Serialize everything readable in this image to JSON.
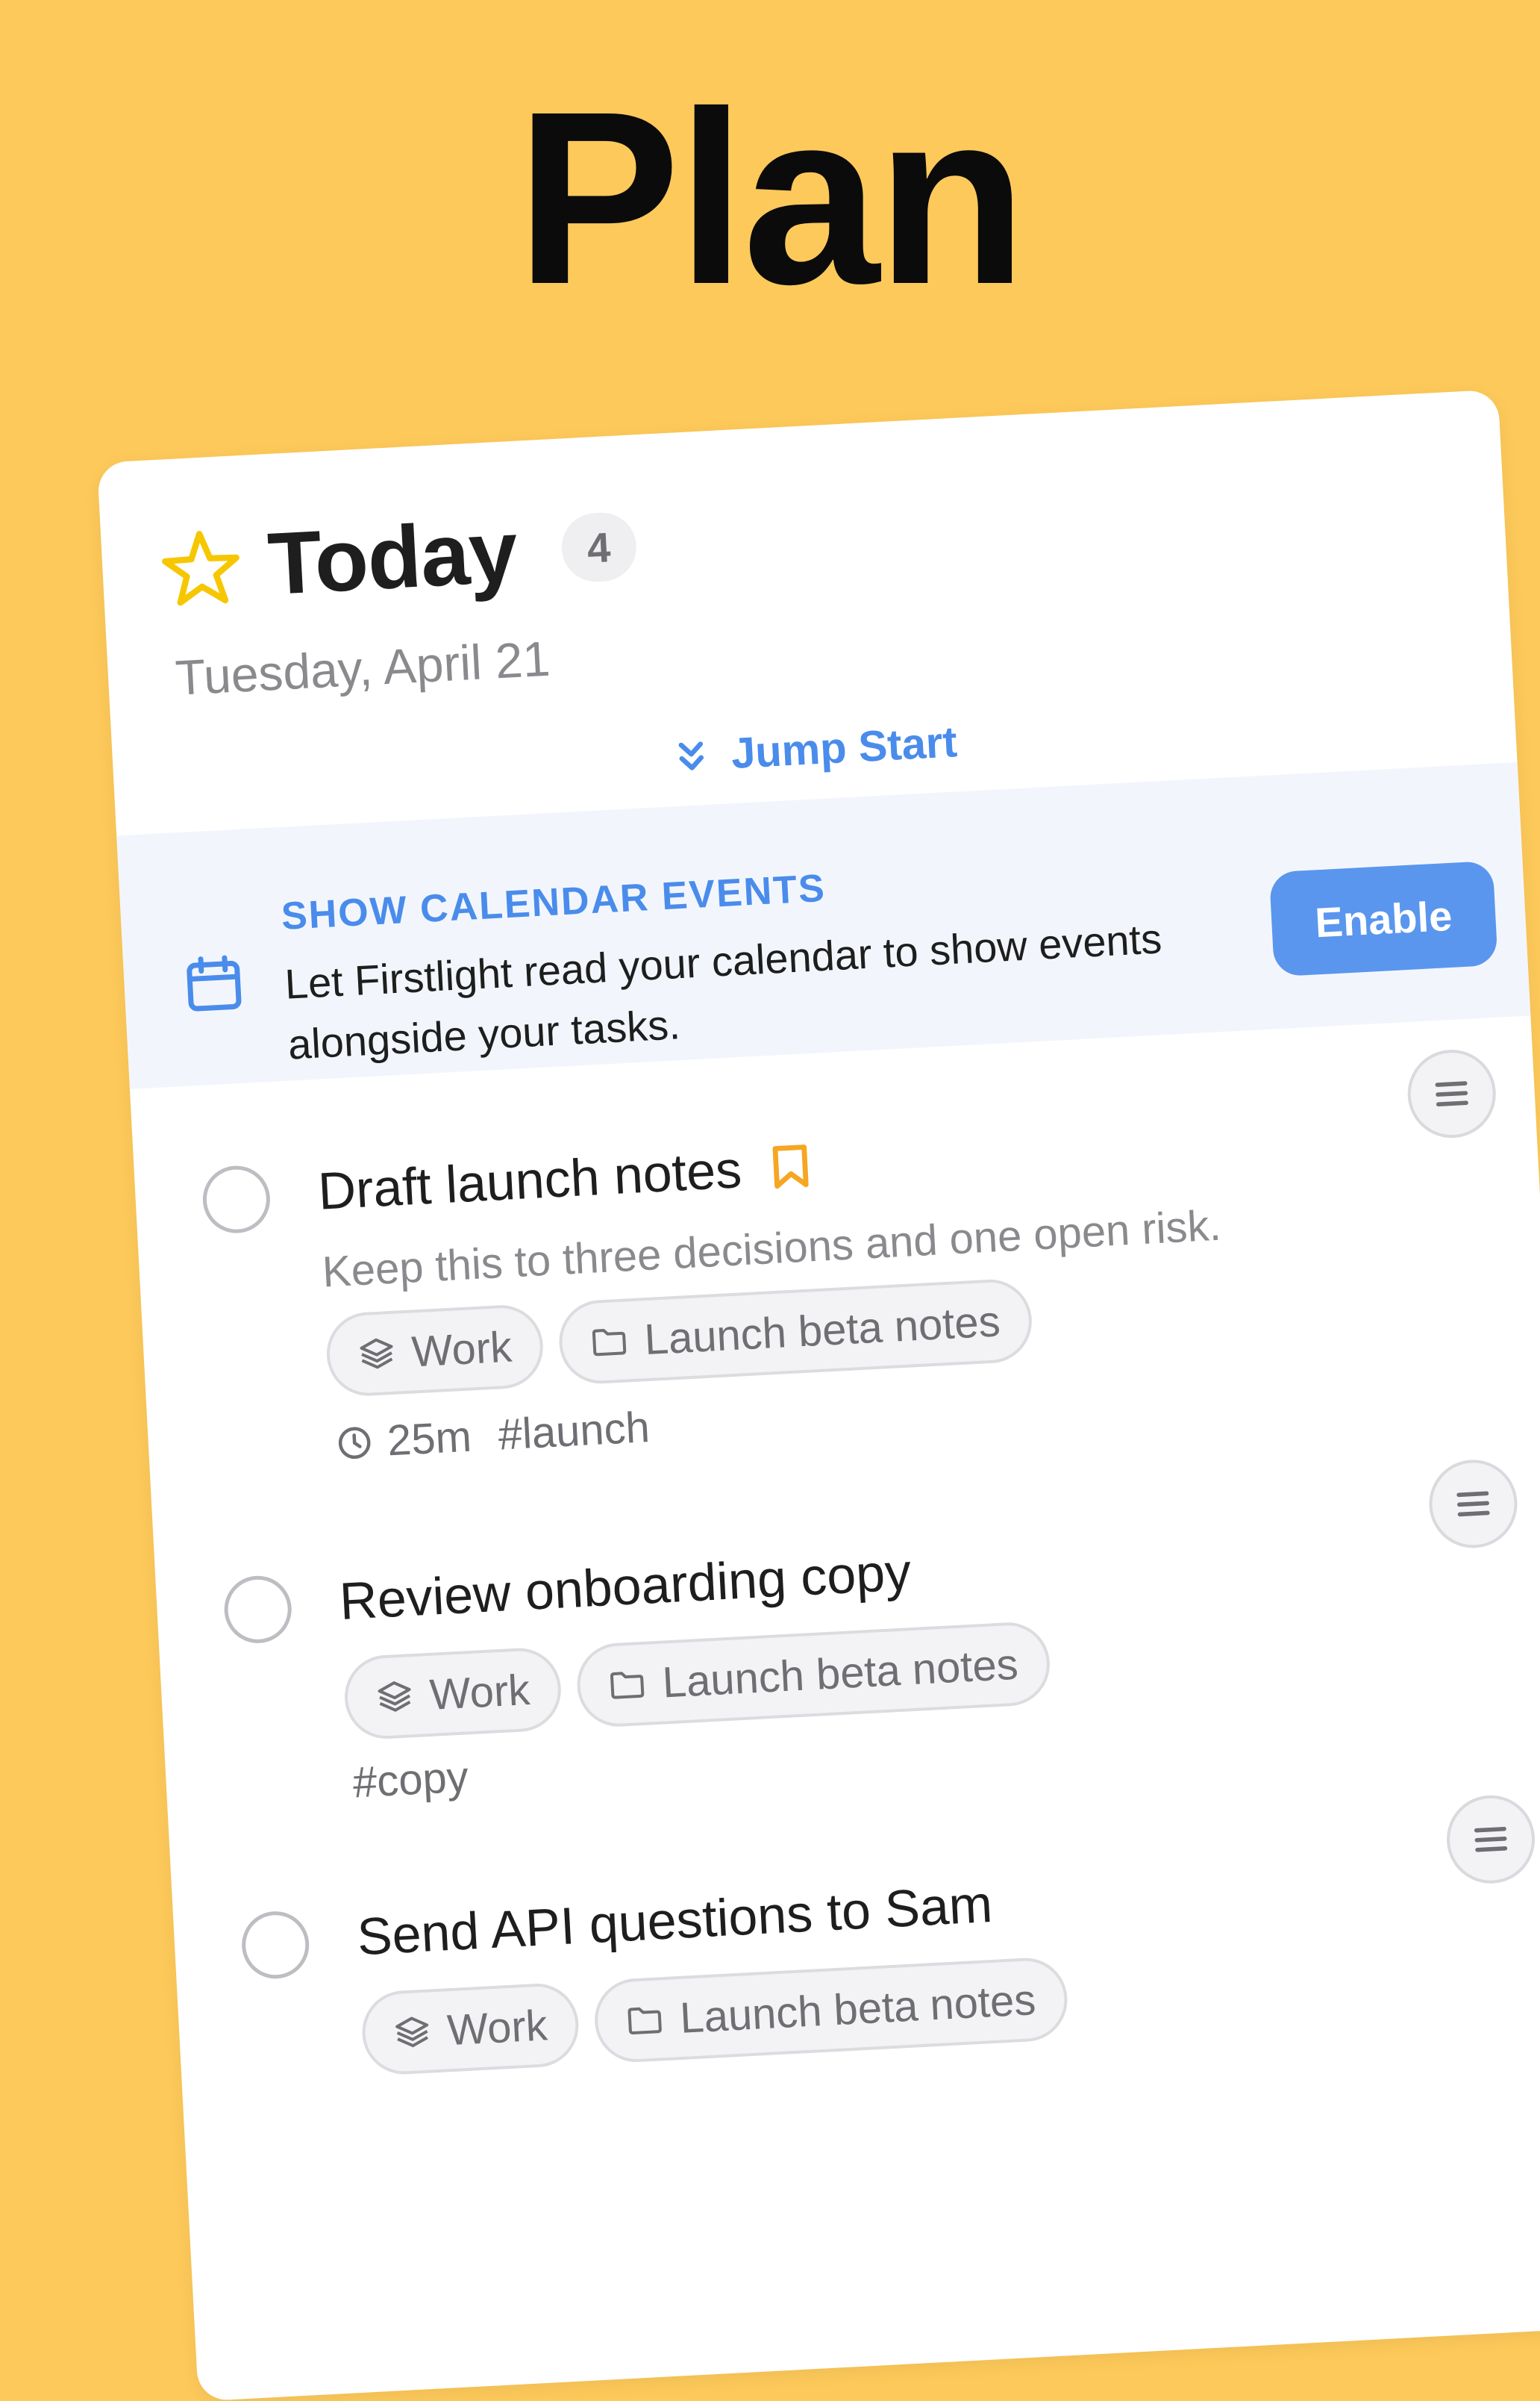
{
  "headline": "Plan",
  "colors": {
    "background": "#FDC95A",
    "accent": "#4A8CEB",
    "star": "#F6C700",
    "bookmark": "#F5A623"
  },
  "header": {
    "title": "Today",
    "count": "4",
    "date": "Tuesday, April 21",
    "icon": "star-icon"
  },
  "jump_start": {
    "label": "Jump Start",
    "icon": "double-chevron-down-icon"
  },
  "calendar_banner": {
    "icon": "calendar-icon",
    "title": "SHOW CALENDAR EVENTS",
    "text": "Let Firstlight read your calendar to show events alongside your tasks.",
    "button": "Enable"
  },
  "tasks": [
    {
      "title": "Draft launch notes",
      "flagged": true,
      "note": "Keep this to three decisions and one open risk.",
      "area": "Work",
      "project": "Launch beta notes",
      "duration": "25m",
      "tag": "#launch"
    },
    {
      "title": "Review onboarding copy",
      "flagged": false,
      "area": "Work",
      "project": "Launch beta notes",
      "tag": "#copy"
    },
    {
      "title": "Send API questions to Sam",
      "flagged": false,
      "area": "Work",
      "project": "Launch beta notes"
    }
  ]
}
